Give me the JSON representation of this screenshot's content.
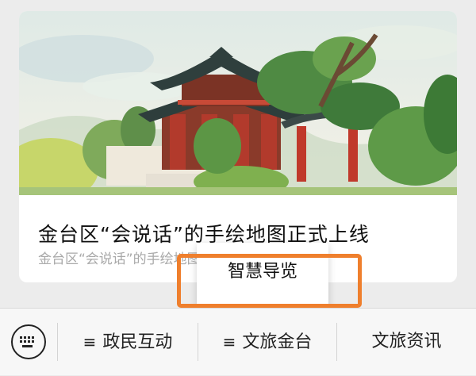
{
  "article": {
    "title": "金台区“会说话”的手绘地图正式上线",
    "subtitle": "金台区“会说话”的手绘地图正式上线金台"
  },
  "popup": {
    "item": "智慧导览",
    "highlight_color": "#ef7f2d"
  },
  "menubar": {
    "keyboard_icon": "keyboard-icon",
    "items": [
      {
        "label": "政民互动",
        "icon": "≡"
      },
      {
        "label": "文旅金台",
        "icon": "≡"
      },
      {
        "label": "文旅资讯"
      }
    ]
  }
}
